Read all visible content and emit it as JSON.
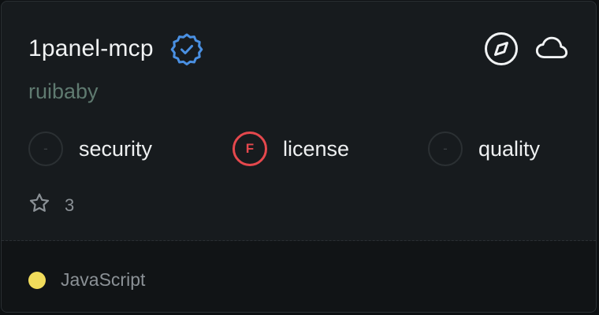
{
  "server": {
    "name": "1panel-mcp",
    "owner": "ruibaby",
    "verified_icon": "verified-badge-icon"
  },
  "actions": {
    "explore_icon": "compass-icon",
    "hosting_icon": "cloud-icon"
  },
  "scores": [
    {
      "grade": "-",
      "label": "security"
    },
    {
      "grade": "F",
      "label": "license"
    },
    {
      "grade": "-",
      "label": "quality"
    }
  ],
  "stars": {
    "icon": "star-icon",
    "count": "3"
  },
  "language": {
    "name": "JavaScript",
    "color": "#f1dc5b"
  },
  "colors": {
    "verified": "#4a90e2",
    "grade_f": "#e5484d"
  }
}
